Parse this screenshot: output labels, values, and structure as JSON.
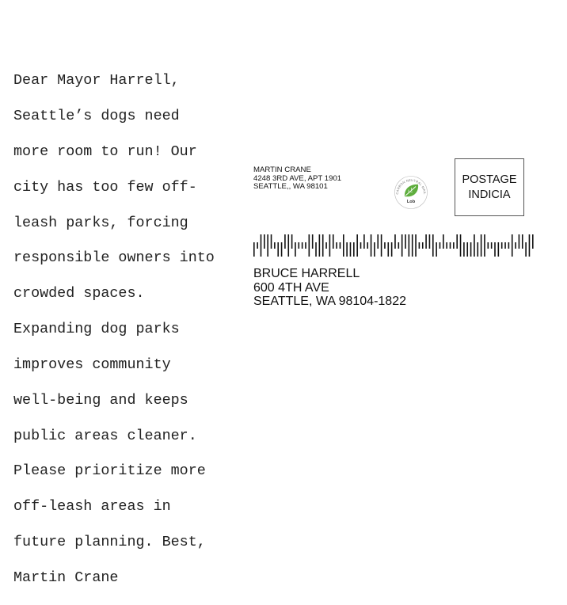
{
  "message": {
    "lines": [
      "Dear Mayor Harrell,",
      "Seattle’s dogs need",
      "more room to run! Our",
      "city has too few off-",
      "leash parks, forcing",
      "responsible owners into",
      "crowded spaces.",
      "Expanding dog parks",
      "improves community",
      "well-being and keeps",
      "public areas cleaner.",
      "Please prioritize more",
      "off-leash areas in",
      "future planning. Best,",
      "Martin Crane"
    ]
  },
  "sender": {
    "name": "MARTIN CRANE",
    "street": "4248 3RD AVE, APT 1901",
    "city_state_zip": "SEATTLE,, WA 98101"
  },
  "seal": {
    "top_text": "CARBON NEUTRAL MAIL",
    "brand": "Lob",
    "color": "#5fae3e"
  },
  "postage": {
    "line1": "POSTAGE",
    "line2": "INDICIA"
  },
  "barcode": {
    "bars": "DTFAFATDDAFADTTTFADFFTFATTFDDDFTATFDAFTDDATFAFFFTTAAFDTATTTAFDDDFDFFTTDDTTTFTAADFA"
  },
  "recipient": {
    "name": "BRUCE HARRELL",
    "street": "600 4TH AVE",
    "city_state_zip": "SEATTLE, WA 98104-1822"
  }
}
